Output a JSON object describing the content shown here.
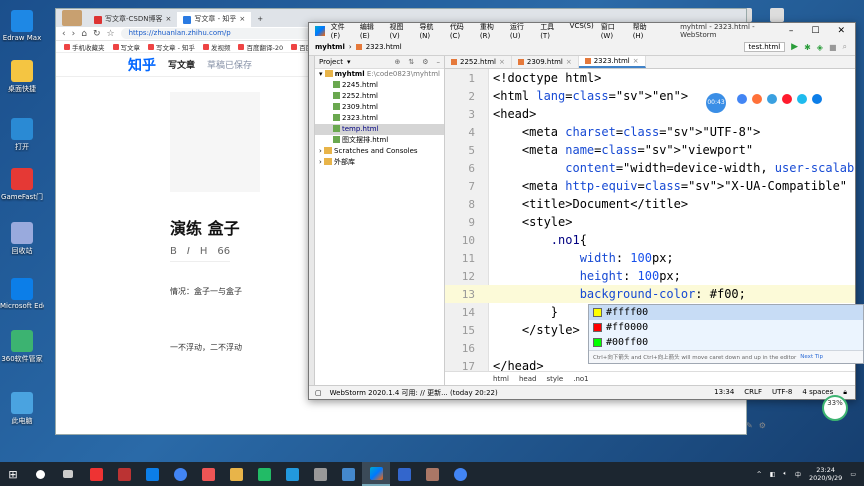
{
  "desktop": {
    "icons": [
      {
        "label": "Edraw Max",
        "color": "#1e88e5"
      },
      {
        "label": "桌面快捷",
        "color": "#f4c542"
      },
      {
        "label": "打开",
        "color": "#2a8ad4"
      },
      {
        "label": "GameFast门",
        "color": "#e53935"
      },
      {
        "label": "回收站",
        "color": "#9ad"
      },
      {
        "label": "Microsoft Edge",
        "color": "#0c7ee8"
      },
      {
        "label": "360软件管家",
        "color": "#3cb371"
      },
      {
        "label": "此电脑",
        "color": "#4aa3e0"
      }
    ]
  },
  "browser": {
    "tabs": [
      {
        "label": "写文章-CSDN博客"
      },
      {
        "label": "写文章 - 知乎"
      }
    ],
    "url": "https://zhuanlan.zhihu.com/p",
    "bookmarks": [
      "手机收藏夹",
      "写文章",
      "写文章 - 知乎",
      "发视频",
      "百度翻译-20",
      "百度图"
    ],
    "zhihu": {
      "logo": "知乎",
      "write": "写文章",
      "draft": "草稿已保存",
      "title": "演练 盒子",
      "toolbar": [
        "B",
        "I",
        "H",
        "66"
      ],
      "para1": "情况：盒子一与盒子",
      "para2": "一不浮动，二不浮动"
    }
  },
  "webstorm": {
    "menu": [
      "文件(F)",
      "编辑(E)",
      "视图(V)",
      "导航(N)",
      "代码(C)",
      "重构(R)",
      "运行(U)",
      "工具(T)",
      "VCS(S)",
      "窗口(W)",
      "帮助(H)"
    ],
    "window_title": "myhtml - 2323.html - WebStorm",
    "nav_project": "myhtml",
    "nav_file": "2323.html",
    "run_config": "test.html",
    "project_header": "Project",
    "tree": [
      {
        "label": "myhtml",
        "path": "E:\\code0823\\myhtml",
        "type": "folder",
        "level": 0
      },
      {
        "label": "2245.html",
        "type": "file",
        "level": 1
      },
      {
        "label": "2252.html",
        "type": "file",
        "level": 1
      },
      {
        "label": "2309.html",
        "type": "file",
        "level": 1
      },
      {
        "label": "2323.html",
        "type": "file",
        "level": 1
      },
      {
        "label": "temp.html",
        "type": "file",
        "level": 1,
        "selected": true
      },
      {
        "label": "图文摆排.html",
        "type": "file",
        "level": 1
      },
      {
        "label": "Scratches and Consoles",
        "type": "folder",
        "level": 0
      },
      {
        "label": "外部库",
        "type": "folder",
        "level": 0
      }
    ],
    "editor_tabs": [
      {
        "label": "2252.html"
      },
      {
        "label": "2309.html"
      },
      {
        "label": "2323.html",
        "active": true
      }
    ],
    "code_lines": [
      {
        "n": "1",
        "html": "<span class=\"tg\">&lt;!doctype html&gt;</span>"
      },
      {
        "n": "2"
      },
      {
        "n": "3"
      },
      {
        "n": "4"
      },
      {
        "n": "5"
      },
      {
        "n": "6"
      },
      {
        "n": "7"
      },
      {
        "n": "8"
      },
      {
        "n": "9"
      },
      {
        "n": "10"
      },
      {
        "n": "11"
      },
      {
        "n": "12"
      },
      {
        "n": "13"
      },
      {
        "n": "14"
      },
      {
        "n": "15"
      },
      {
        "n": "16"
      },
      {
        "n": "17"
      }
    ],
    "code_text": [
      "<!doctype html>",
      "<html lang=\"en\">",
      "<head>",
      "    <meta charset=\"UTF-8\">",
      "    <meta name=\"viewport\"",
      "          content=\"width=device-width, user-scalable=n",
      "    <meta http-equiv=\"X-UA-Compatible\" content=\"ie=edg",
      "    <title>Document</title>",
      "    <style>",
      "        .no1{",
      "            width: 100px;",
      "            height: 100px;",
      "            background-color: #f00;",
      "        }",
      "    </style>",
      "",
      "</head>"
    ],
    "completion": [
      {
        "text": "#ffff00",
        "color": "#ffff00"
      },
      {
        "text": "#ff0000",
        "color": "#ff0000"
      },
      {
        "text": "#00ff00",
        "color": "#00ff00"
      }
    ],
    "completion_hint": "Ctrl+向下箭头 and Ctrl+向上箭头 will move caret down and up in the editor",
    "completion_next_tip": "Next Tip",
    "breadcrumbs": [
      "html",
      "head",
      "style",
      ".no1"
    ],
    "status_left": "WebStorm 2020.1.4 可用: // 更新... (today 20:22)",
    "status_right": [
      "13:34",
      "CRLF",
      "UTF-8",
      "4 spaces"
    ]
  },
  "floating": {
    "badge": "00:43",
    "gauge": "33%"
  },
  "taskbar": {
    "time": "23:24",
    "date": "2020/9/29"
  }
}
